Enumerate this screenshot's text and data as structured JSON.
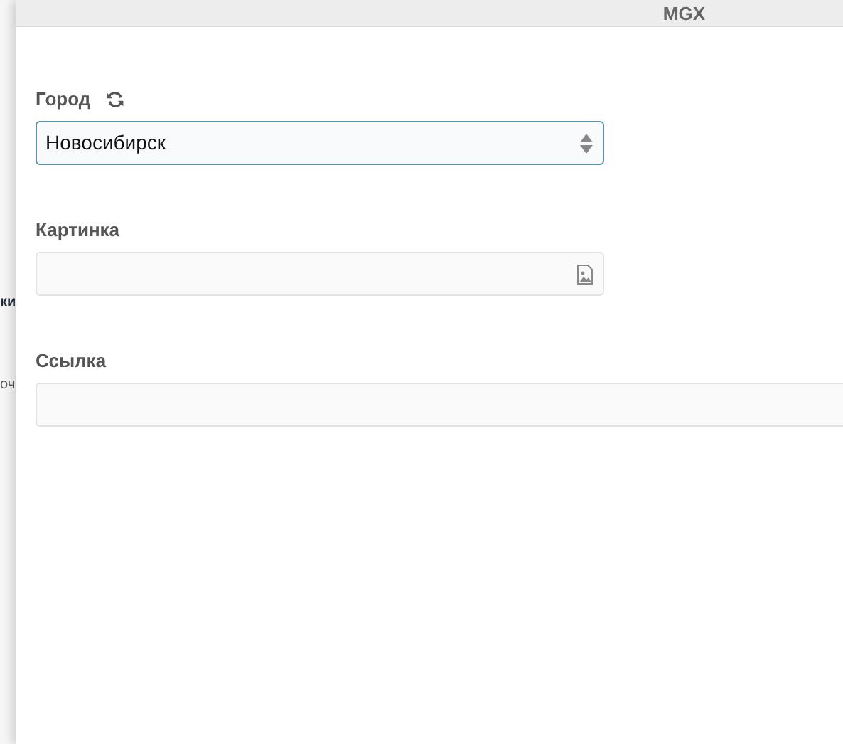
{
  "background_page": {
    "fragments": [
      {
        "text": "ки",
        "kind": "heading"
      },
      {
        "text": "оч",
        "kind": "body"
      }
    ]
  },
  "panel": {
    "header": {
      "title": "MGX"
    },
    "fields": [
      {
        "label": "Город",
        "kind": "select",
        "value": "Новосибирск",
        "refresh": true
      },
      {
        "label": "Картинка",
        "kind": "image",
        "refresh": false
      },
      {
        "label": "Ссылка",
        "kind": "text",
        "refresh": false
      }
    ]
  }
}
